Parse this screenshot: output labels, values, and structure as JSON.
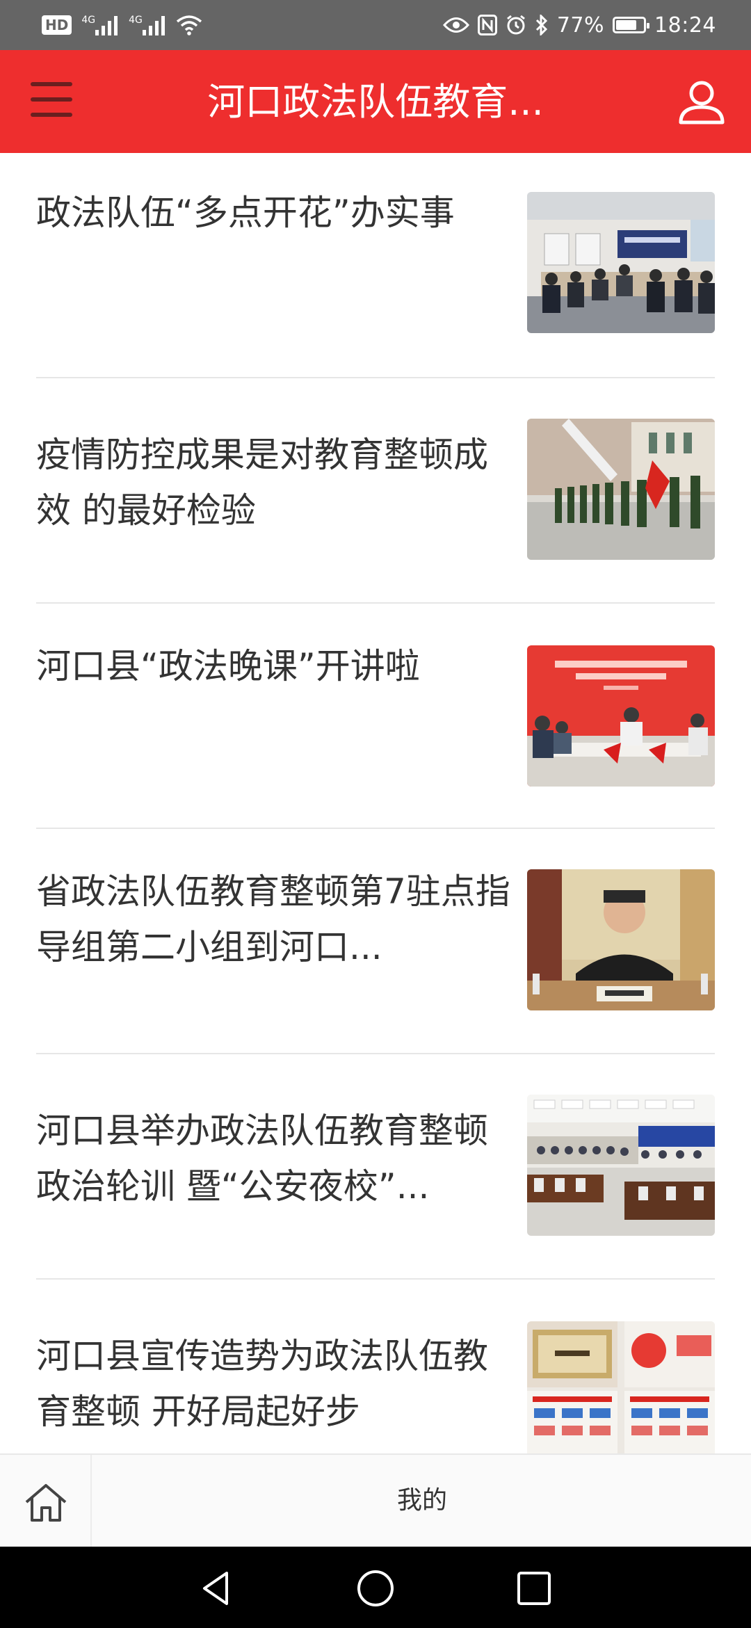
{
  "status_bar": {
    "hd_badge": "HD",
    "net1": "4G",
    "net2": "4G",
    "battery_pct": "77%",
    "battery_level": 0.77,
    "time": "18:24"
  },
  "app_bar": {
    "title": "河口政法队伍教育...",
    "menu_icon": "hamburger-menu-icon",
    "user_icon": "user-profile-icon"
  },
  "articles": [
    {
      "title": "政法队伍“多点开花”办实事",
      "thumb": "meeting-room-photo"
    },
    {
      "title": "疫情防控成果是对教育整顿成效 的最好检验",
      "thumb": "honor-guard-photo"
    },
    {
      "title": "河口县“政法晚课”开讲啦",
      "thumb": "evening-class-photo"
    },
    {
      "title": "省政法队伍教育整顿第7驻点指导组第二小组到河口...",
      "thumb": "official-portrait-photo"
    },
    {
      "title": "河口县举办政法队伍教育整顿政治轮训 暨“公安夜校”...",
      "thumb": "training-hall-photo"
    },
    {
      "title": "河口县宣传造势为政法队伍教育整顿 开好局起好步",
      "thumb": "office-posters-photo"
    }
  ],
  "bottom_nav": {
    "home_icon": "home-icon",
    "mine_label": "我的"
  },
  "system_nav": {
    "back": "back-triangle-icon",
    "home": "home-circle-icon",
    "recents": "recents-square-icon"
  },
  "colors": {
    "app_bar": "#ee2e2e",
    "status_bar": "#656565",
    "title_text": "#333333"
  }
}
